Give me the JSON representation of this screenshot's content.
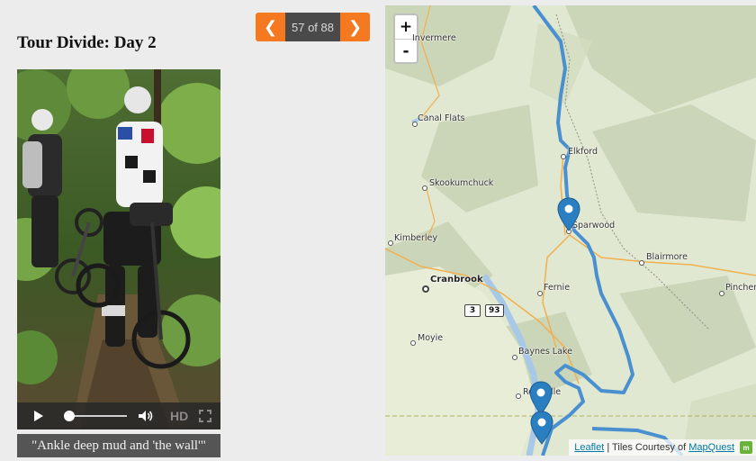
{
  "page": {
    "title": "Tour Divide: Day 2"
  },
  "pager": {
    "prev_icon": "chevron-left-icon",
    "next_icon": "chevron-right-icon",
    "prev_glyph": "❮",
    "next_glyph": "❯",
    "count_text": "57 of 88"
  },
  "video": {
    "controls": {
      "hd_label": "HD",
      "progress": 0.0
    },
    "caption": "\"Ankle deep mud and 'the wall'\""
  },
  "map": {
    "zoom_in": "+",
    "zoom_out": "-",
    "places": [
      {
        "name": "Invermere"
      },
      {
        "name": "Canal Flats"
      },
      {
        "name": "Elkford"
      },
      {
        "name": "Skookumchuck"
      },
      {
        "name": "Sparwood"
      },
      {
        "name": "Kimberley"
      },
      {
        "name": "Blairmore"
      },
      {
        "name": "Cranbrook"
      },
      {
        "name": "Fernie"
      },
      {
        "name": "Pincher"
      },
      {
        "name": "Moyie"
      },
      {
        "name": "Baynes Lake"
      },
      {
        "name": "Roosville"
      }
    ],
    "shields": [
      "3",
      "93"
    ],
    "attribution": {
      "leaflet": "Leaflet",
      "tiles_text": "| Tiles Courtesy of",
      "mapquest": "MapQuest"
    },
    "colors": {
      "route": "#4a90d0",
      "water": "#a8c8e8",
      "road": "#f0b050",
      "marker": "#2a7fc1"
    }
  }
}
